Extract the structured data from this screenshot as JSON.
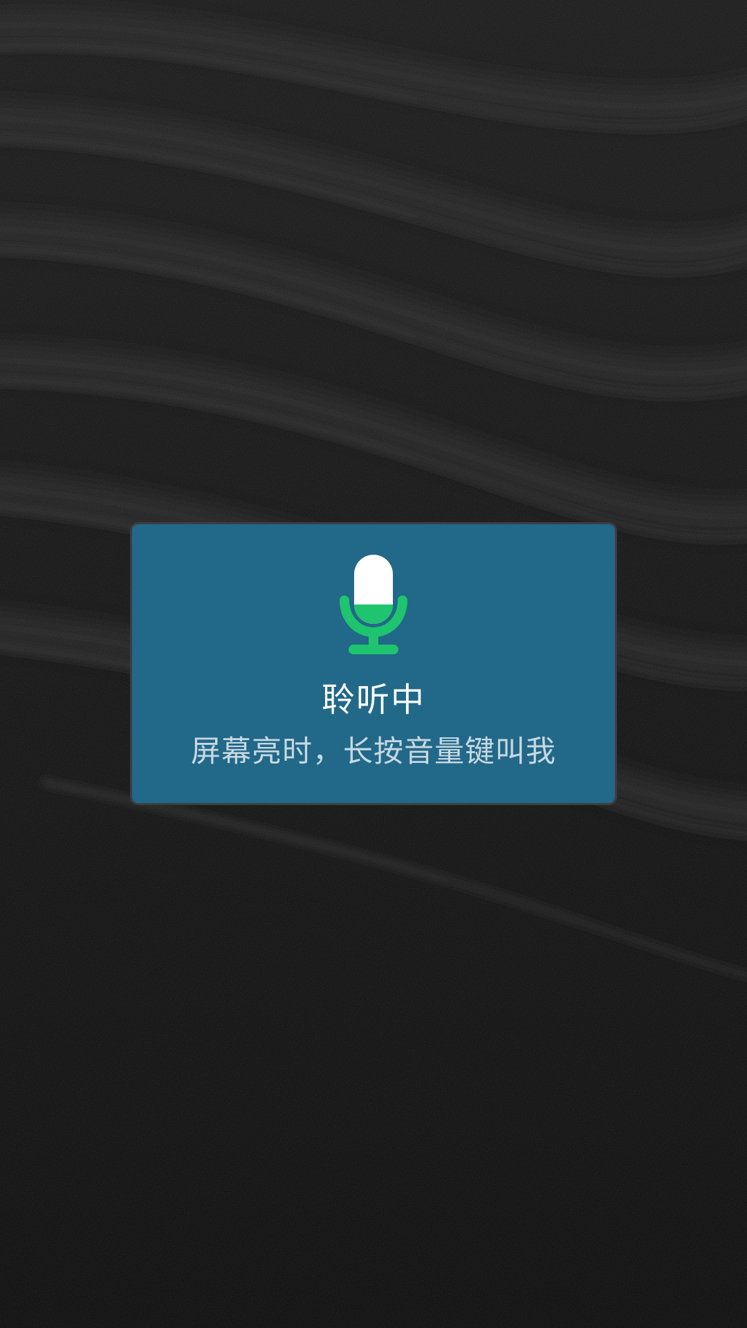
{
  "wallpaper": {
    "description_icon": "dark-sand-dunes-wallpaper",
    "base_color": "#0d0d0d",
    "ridge_color": "#2a2a2a"
  },
  "voice_dialog": {
    "icon": "microphone-icon",
    "title": "聆听中",
    "hint": "屏幕亮时，长按音量键叫我",
    "background_color": "#226888",
    "accent_color": "#1ec46e"
  }
}
